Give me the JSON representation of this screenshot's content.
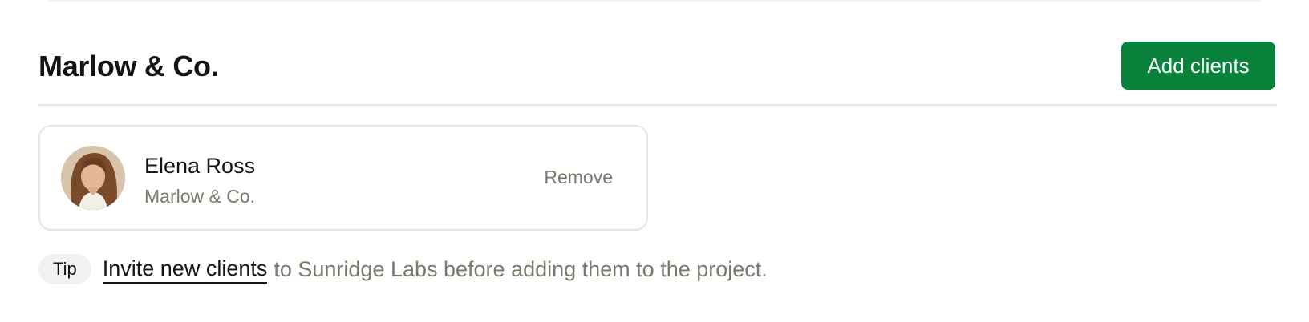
{
  "section": {
    "title": "Marlow & Co.",
    "add_button_label": "Add clients"
  },
  "clients": [
    {
      "name": "Elena Ross",
      "company": "Marlow & Co.",
      "remove_label": "Remove",
      "avatar_icon": "avatar-photo"
    }
  ],
  "tip": {
    "badge": "Tip",
    "link_text": "Invite new clients",
    "text": "to Sunridge Labs before adding them to the project."
  },
  "colors": {
    "accent": "#08813a",
    "muted_text": "#777a6a",
    "primary_text": "#141414"
  }
}
